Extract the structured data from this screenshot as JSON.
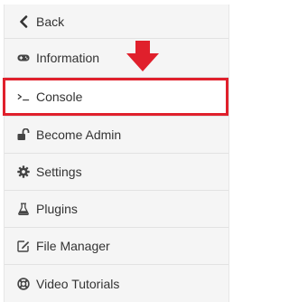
{
  "menu": {
    "items": [
      {
        "label": "Back",
        "icon": "chevron-left-icon"
      },
      {
        "label": "Information",
        "icon": "gamepad-icon"
      },
      {
        "label": "Console",
        "icon": "terminal-icon"
      },
      {
        "label": "Become Admin",
        "icon": "unlock-icon"
      },
      {
        "label": "Settings",
        "icon": "gear-icon"
      },
      {
        "label": "Plugins",
        "icon": "flask-icon"
      },
      {
        "label": "File Manager",
        "icon": "edit-icon"
      },
      {
        "label": "Video Tutorials",
        "icon": "lifebuoy-icon"
      }
    ]
  },
  "annotation": {
    "highlight_color": "#e0202c",
    "highlighted_item": "Console"
  }
}
